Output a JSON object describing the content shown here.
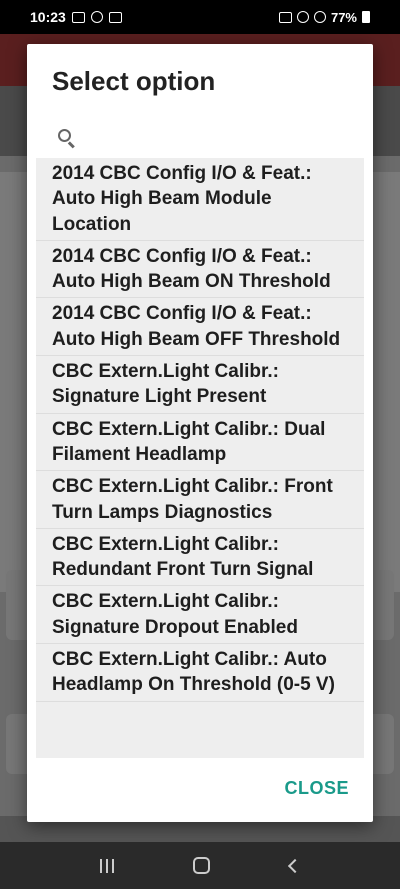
{
  "status_bar": {
    "time": "10:23",
    "battery": "77%"
  },
  "dialog": {
    "title": "Select option",
    "search": {
      "value": "",
      "placeholder": ""
    },
    "items": [
      "2014 CBC Config I/O & Feat.: Auto High Beam Module Location",
      "2014 CBC Config I/O & Feat.: Auto High Beam ON Threshold",
      "2014 CBC Config I/O & Feat.: Auto High Beam OFF Threshold",
      "CBC Extern.Light Calibr.: Signature Light Present",
      "CBC Extern.Light Calibr.: Dual Filament Headlamp",
      "CBC Extern.Light Calibr.: Front Turn Lamps Diagnostics",
      "CBC Extern.Light Calibr.: Redundant Front Turn Signal",
      "CBC Extern.Light Calibr.: Signature Dropout Enabled",
      "CBC Extern.Light Calibr.: Auto Headlamp On Threshold (0-5 V)"
    ],
    "close_label": "CLOSE"
  },
  "colors": {
    "accent": "#1a9a8a",
    "list_bg": "#eeeeee",
    "scrim": "#6b6b6b"
  },
  "icons": {
    "search": "search-icon",
    "nav_recent": "recent-apps-icon",
    "nav_home": "home-icon",
    "nav_back": "back-icon"
  }
}
